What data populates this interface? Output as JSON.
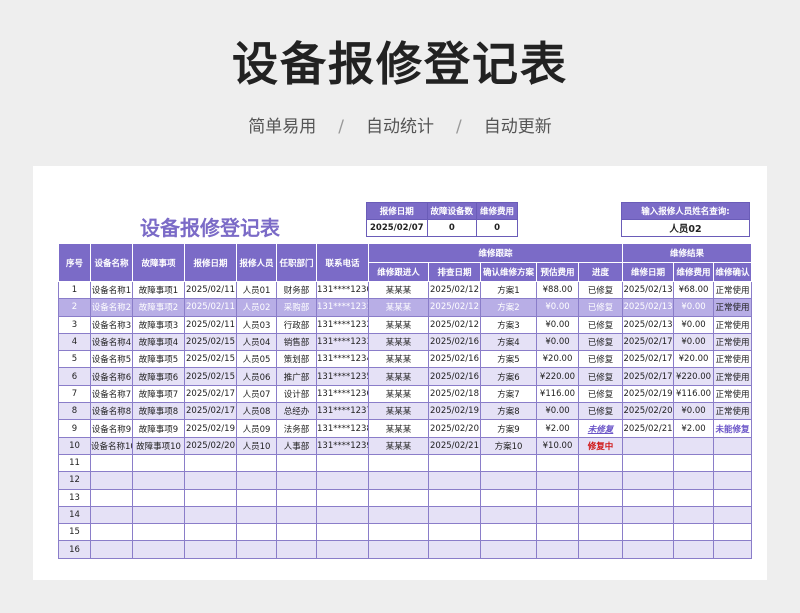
{
  "poster": {
    "title": "设备报修登记表",
    "tags": [
      "简单易用",
      "自动统计",
      "自动更新"
    ],
    "separator": "/"
  },
  "sheet": {
    "title": "设备报修登记表",
    "summary": {
      "headers": [
        "报修日期",
        "故障设备数",
        "维修费用"
      ],
      "values": [
        "2025/02/07",
        "0",
        "0"
      ]
    },
    "query": {
      "label": "输入报修人员姓名查询:",
      "value": "人员02"
    },
    "group_headers": {
      "tracking": "维修跟踪",
      "result": "维修结果"
    },
    "columns": {
      "seq": "序号",
      "device": "设备名称",
      "fault": "故障事项",
      "date": "报修日期",
      "reporter": "报修人员",
      "dept": "任职部门",
      "phone": "联系电话",
      "tracker": "维修跟进人",
      "check_date": "排查日期",
      "plan": "确认维修方案",
      "est_cost": "预估费用",
      "progress": "进度",
      "fix_date": "维修日期",
      "fix_cost": "维修费用",
      "confirm": "维修确认"
    },
    "rows": [
      [
        "1",
        "设备名称1",
        "故障事项1",
        "2025/02/11",
        "人员01",
        "财务部",
        "131****1230",
        "某某某",
        "2025/02/12",
        "方案1",
        "¥88.00",
        "已修复",
        "2025/02/13",
        "¥68.00",
        "正常使用"
      ],
      [
        "2",
        "设备名称2",
        "故障事项2",
        "2025/02/11",
        "人员02",
        "采购部",
        "131****1231",
        "某某某",
        "2025/02/12",
        "方案2",
        "¥0.00",
        "已修复",
        "2025/02/13",
        "¥0.00",
        "正常使用"
      ],
      [
        "3",
        "设备名称3",
        "故障事项3",
        "2025/02/11",
        "人员03",
        "行政部",
        "131****1232",
        "某某某",
        "2025/02/12",
        "方案3",
        "¥0.00",
        "已修复",
        "2025/02/13",
        "¥0.00",
        "正常使用"
      ],
      [
        "4",
        "设备名称4",
        "故障事项4",
        "2025/02/15",
        "人员04",
        "销售部",
        "131****1233",
        "某某某",
        "2025/02/16",
        "方案4",
        "¥0.00",
        "已修复",
        "2025/02/17",
        "¥0.00",
        "正常使用"
      ],
      [
        "5",
        "设备名称5",
        "故障事项5",
        "2025/02/15",
        "人员05",
        "策划部",
        "131****1234",
        "某某某",
        "2025/02/16",
        "方案5",
        "¥20.00",
        "已修复",
        "2025/02/17",
        "¥20.00",
        "正常使用"
      ],
      [
        "6",
        "设备名称6",
        "故障事项6",
        "2025/02/15",
        "人员06",
        "推广部",
        "131****1235",
        "某某某",
        "2025/02/16",
        "方案6",
        "¥220.00",
        "已修复",
        "2025/02/17",
        "¥220.00",
        "正常使用"
      ],
      [
        "7",
        "设备名称7",
        "故障事项7",
        "2025/02/17",
        "人员07",
        "设计部",
        "131****1236",
        "某某某",
        "2025/02/18",
        "方案7",
        "¥116.00",
        "已修复",
        "2025/02/19",
        "¥116.00",
        "正常使用"
      ],
      [
        "8",
        "设备名称8",
        "故障事项8",
        "2025/02/17",
        "人员08",
        "总经办",
        "131****1237",
        "某某某",
        "2025/02/19",
        "方案8",
        "¥0.00",
        "已修复",
        "2025/02/20",
        "¥0.00",
        "正常使用"
      ],
      [
        "9",
        "设备名称9",
        "故障事项9",
        "2025/02/19",
        "人员09",
        "法务部",
        "131****1238",
        "某某某",
        "2025/02/20",
        "方案9",
        "¥2.00",
        "未修复",
        "2025/02/21",
        "¥2.00",
        "未能修复"
      ],
      [
        "10",
        "设备名称10",
        "故障事项10",
        "2025/02/20",
        "人员10",
        "人事部",
        "131****1239",
        "某某某",
        "2025/02/21",
        "方案10",
        "¥10.00",
        "修复中",
        "",
        "",
        ""
      ],
      [
        "11",
        "",
        "",
        "",
        "",
        "",
        "",
        "",
        "",
        "",
        "",
        "",
        "",
        "",
        ""
      ],
      [
        "12",
        "",
        "",
        "",
        "",
        "",
        "",
        "",
        "",
        "",
        "",
        "",
        "",
        "",
        ""
      ],
      [
        "13",
        "",
        "",
        "",
        "",
        "",
        "",
        "",
        "",
        "",
        "",
        "",
        "",
        "",
        ""
      ],
      [
        "14",
        "",
        "",
        "",
        "",
        "",
        "",
        "",
        "",
        "",
        "",
        "",
        "",
        "",
        ""
      ],
      [
        "15",
        "",
        "",
        "",
        "",
        "",
        "",
        "",
        "",
        "",
        "",
        "",
        "",
        "",
        ""
      ],
      [
        "16",
        "",
        "",
        "",
        "",
        "",
        "",
        "",
        "",
        "",
        "",
        "",
        "",
        "",
        ""
      ]
    ],
    "highlight_row": 2,
    "colors": {
      "accent": "#7b6bc7",
      "row_alt": "#e5e1f6",
      "row_highlight": "#b8aee6",
      "warn": "#6a55c8",
      "danger": "#d01616"
    }
  }
}
